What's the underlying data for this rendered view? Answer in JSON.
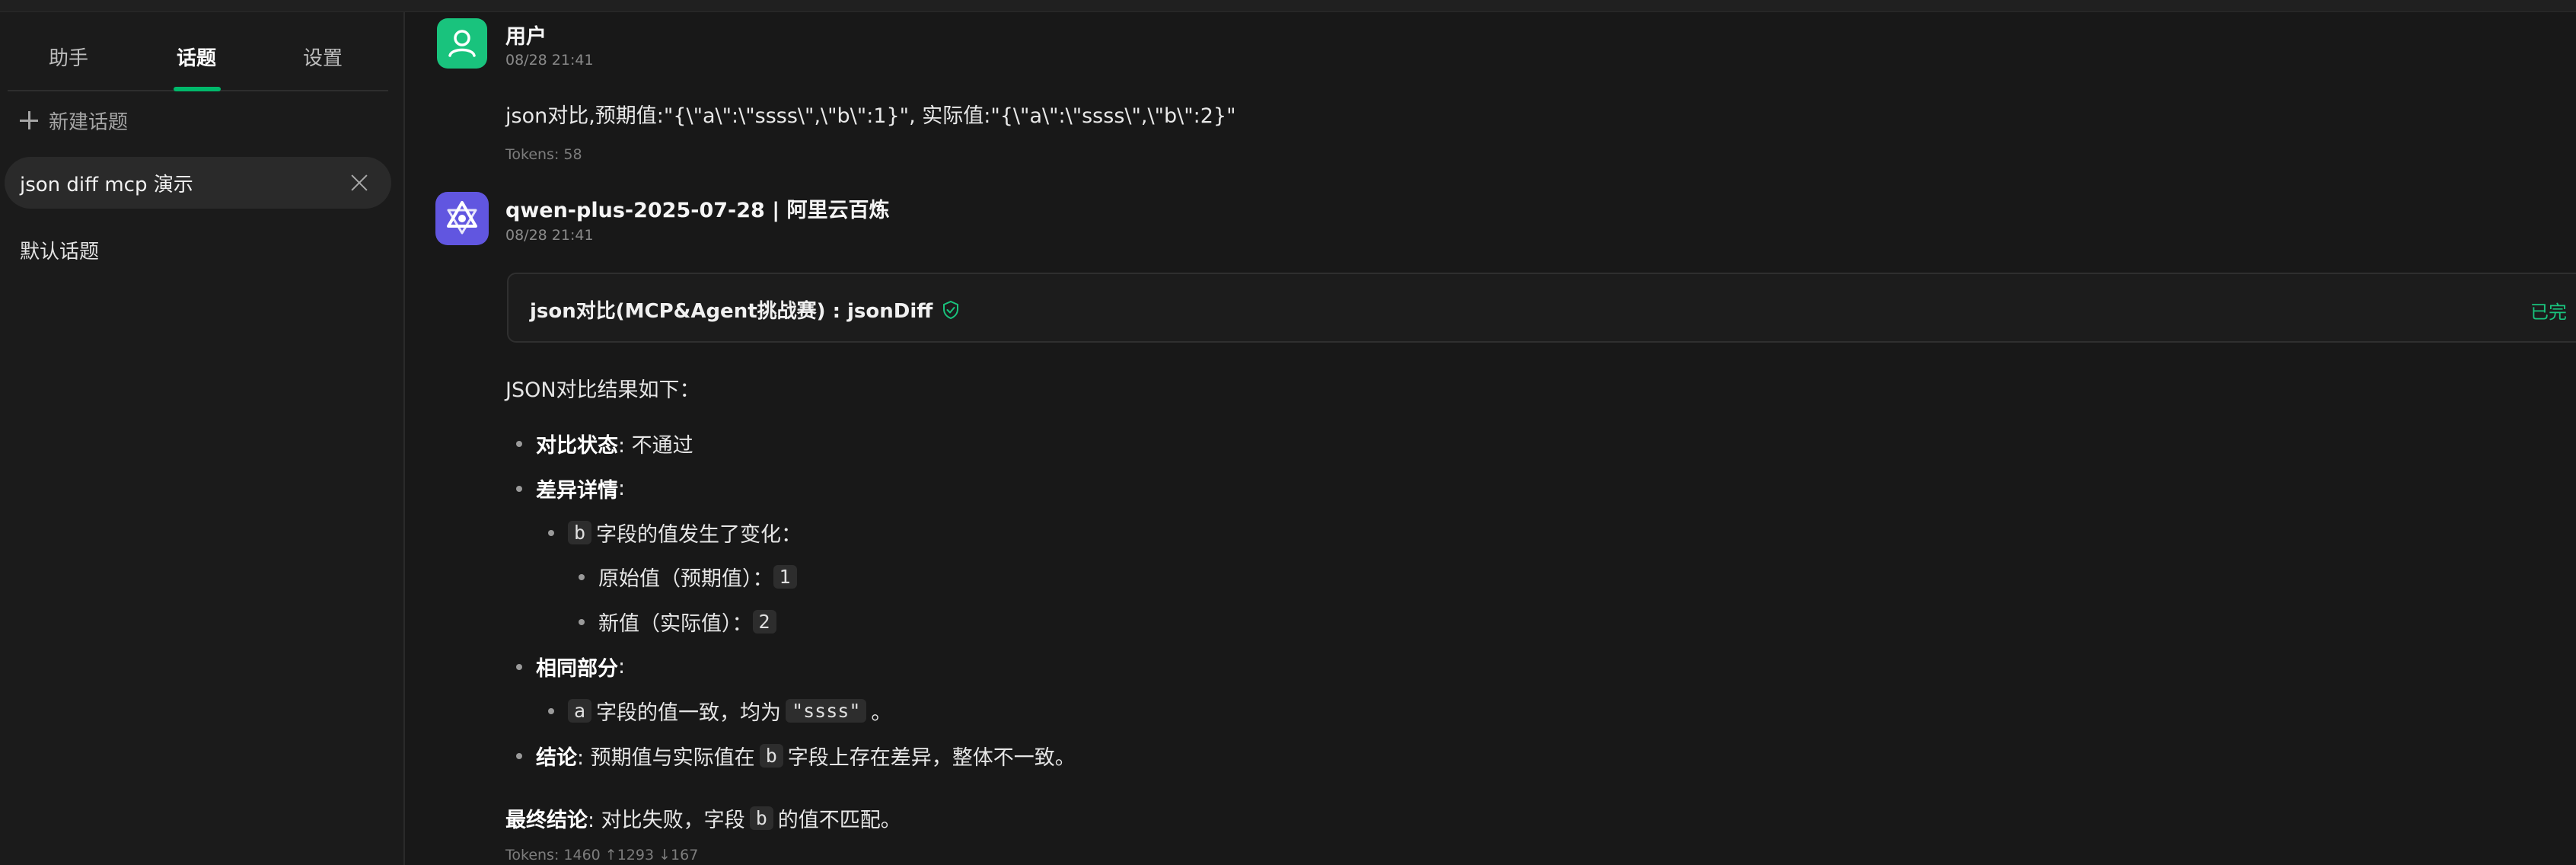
{
  "sidebar": {
    "tabs": [
      {
        "label": "助手"
      },
      {
        "label": "话题"
      },
      {
        "label": "设置"
      }
    ],
    "new_topic_label": "新建话题",
    "active_topic": "json diff mcp 演示",
    "default_topic": "默认话题"
  },
  "messages": {
    "user": {
      "name": "用户",
      "time": "08/28 21:41",
      "text": "json对比,预期值:\"{\\\"a\\\":\\\"ssss\\\",\\\"b\\\":1}\", 实际值:\"{\\\"a\\\":\\\"ssss\\\",\\\"b\\\":2}\"",
      "tokens": "Tokens: 58"
    },
    "assistant": {
      "name": "qwen-plus-2025-07-28 | 阿里云百炼",
      "time": "08/28 21:41",
      "tool_call": "json对比(MCP&Agent挑战赛) : jsonDiff",
      "tool_status": "已完",
      "intro": "JSON对比结果如下：",
      "status_label": "对比状态",
      "status_value": ": 不通过",
      "diff_label": "差异详情",
      "colon": ":",
      "diff_field": "b",
      "diff_text": "字段的值发生了变化：",
      "orig_label": "原始值（预期值）：",
      "orig_value": "1",
      "new_label": "新值（实际值）：",
      "new_value": "2",
      "same_label": "相同部分",
      "same_field": "a",
      "same_text": "字段的值一致，均为",
      "same_value": "\"ssss\"",
      "period": "。",
      "conclusion_label": "结论",
      "conclusion_pre": ": 预期值与实际值在",
      "conclusion_field": "b",
      "conclusion_post": "字段上存在差异，整体不一致。",
      "final_label": "最终结论",
      "final_pre": ": 对比失败，字段",
      "final_field": "b",
      "final_post": "的值不匹配。",
      "tokens": "Tokens: 1460 ↑1293 ↓167"
    }
  },
  "colors": {
    "accent": "#00b96b",
    "user_avatar": "#19c37d",
    "bot_avatar": "#6156e0"
  }
}
